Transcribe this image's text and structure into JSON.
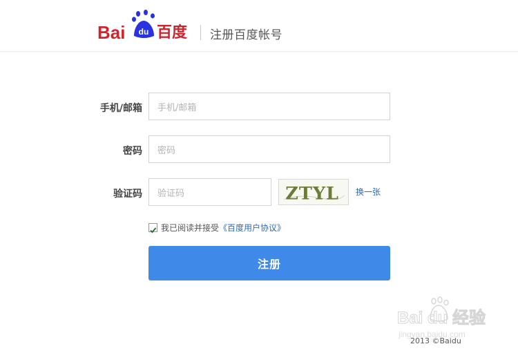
{
  "header": {
    "logo_text": "Bai du 百度",
    "title": "注册百度帐号"
  },
  "form": {
    "phone_label": "手机/邮箱",
    "phone_placeholder": "手机/邮箱",
    "password_label": "密码",
    "password_placeholder": "密码",
    "captcha_label": "验证码",
    "captcha_placeholder": "验证码",
    "captcha_text": "ZTYL",
    "refresh_label": "换一张",
    "agree_prefix": "我已阅读并接受",
    "agree_link": "《百度用户协议》",
    "agree_checked": true,
    "submit_label": "注册"
  },
  "footer": {
    "watermark_text": "Bai du 经验",
    "watermark_url": "jingyan.baidu.com",
    "copyright": "2013 ©Baidu"
  },
  "colors": {
    "brand_red": "#d3232a",
    "brand_blue": "#2932e1",
    "button_blue": "#3f8ae8",
    "link_blue": "#2a6bbf"
  }
}
